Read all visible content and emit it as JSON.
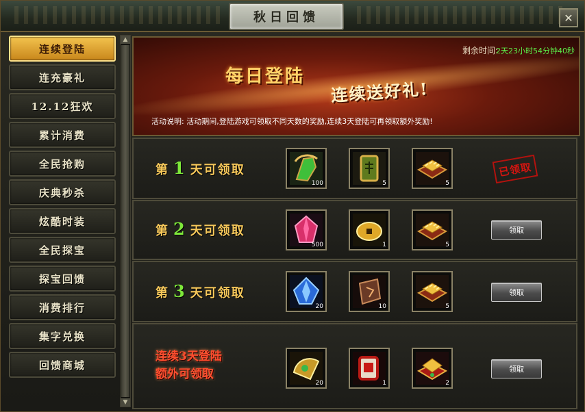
{
  "window": {
    "title": "秋日回馈",
    "close_label": "✕"
  },
  "sidebar": {
    "items": [
      {
        "label": "连续登陆",
        "active": true
      },
      {
        "label": "连充豪礼",
        "active": false
      },
      {
        "label": "12.12狂欢",
        "active": false
      },
      {
        "label": "累计消费",
        "active": false
      },
      {
        "label": "全民抢购",
        "active": false
      },
      {
        "label": "庆典秒杀",
        "active": false
      },
      {
        "label": "炫酷时装",
        "active": false
      },
      {
        "label": "全民探宝",
        "active": false
      },
      {
        "label": "探宝回馈",
        "active": false
      },
      {
        "label": "消费排行",
        "active": false
      },
      {
        "label": "集字兑换",
        "active": false
      },
      {
        "label": "回馈商城",
        "active": false
      }
    ]
  },
  "banner": {
    "countdown_label": "剩余时间:",
    "countdown_value": "2天23小时54分钟40秒",
    "title_1": "每日登陆",
    "title_2": "连续送好礼!",
    "description": "活动说明: 活动期间,登陆游戏可领取不同天数的奖励,连续3天登陆可再领取额外奖励!"
  },
  "rows": [
    {
      "prefix": "第",
      "day": "1",
      "suffix": "天可领取",
      "rewards": [
        {
          "icon": "green-gauntlet-icon",
          "count": "100"
        },
        {
          "icon": "jade-token-icon",
          "count": "5"
        },
        {
          "icon": "gold-chest-icon",
          "count": "5"
        }
      ],
      "status": "已领取",
      "claimed": true
    },
    {
      "prefix": "第",
      "day": "2",
      "suffix": "天可领取",
      "rewards": [
        {
          "icon": "pink-crystal-icon",
          "count": "500"
        },
        {
          "icon": "gold-coin-icon",
          "count": "1"
        },
        {
          "icon": "gold-chest-icon",
          "count": "5"
        }
      ],
      "button_label": "领取",
      "claimed": false
    },
    {
      "prefix": "第",
      "day": "3",
      "suffix": "天可领取",
      "rewards": [
        {
          "icon": "blue-crystal-icon",
          "count": "20"
        },
        {
          "icon": "rune-stone-icon",
          "count": "10"
        },
        {
          "icon": "gold-chest-icon",
          "count": "5"
        }
      ],
      "button_label": "领取",
      "claimed": false
    }
  ],
  "bonus_row": {
    "line_1": "连续3天登陆",
    "line_2": "额外可领取",
    "rewards": [
      {
        "icon": "gold-ornament-icon",
        "count": "20"
      },
      {
        "icon": "red-scroll-icon",
        "count": "1"
      },
      {
        "icon": "red-gold-chest-icon",
        "count": "2"
      }
    ],
    "button_label": "领取"
  },
  "colors": {
    "accent": "#f3c34e",
    "day_number": "#7ee83a",
    "bonus_text": "#ff4d2e",
    "countdown": "#5cf04a",
    "stamp": "#d41510"
  }
}
